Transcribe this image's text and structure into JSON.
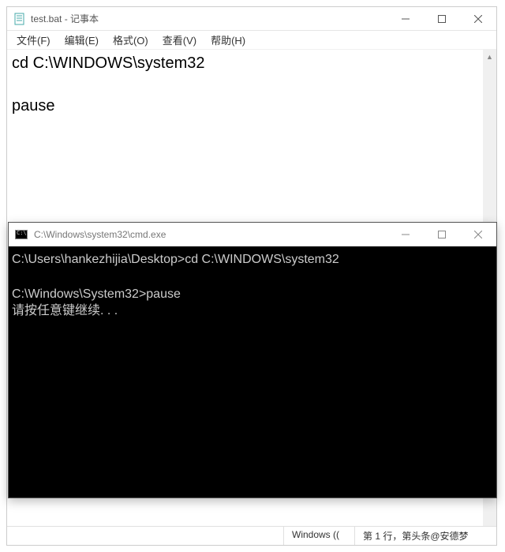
{
  "notepad": {
    "title": "test.bat - 记事本",
    "menu": {
      "file": "文件(F)",
      "edit": "编辑(E)",
      "format": "格式(O)",
      "view": "查看(V)",
      "help": "帮助(H)"
    },
    "content_line1": "cd C:\\WINDOWS\\system32",
    "content_line2": "",
    "content_line3": "pause",
    "status": {
      "left": "Windows ((",
      "pos": "第 1 行，第头条@安德梦"
    }
  },
  "cmd": {
    "title": "C:\\Windows\\system32\\cmd.exe",
    "line1": "C:\\Users\\hankezhijia\\Desktop>cd C:\\WINDOWS\\system32",
    "line2": "",
    "line3": "C:\\Windows\\System32>pause",
    "line4": "请按任意键继续. . ."
  }
}
